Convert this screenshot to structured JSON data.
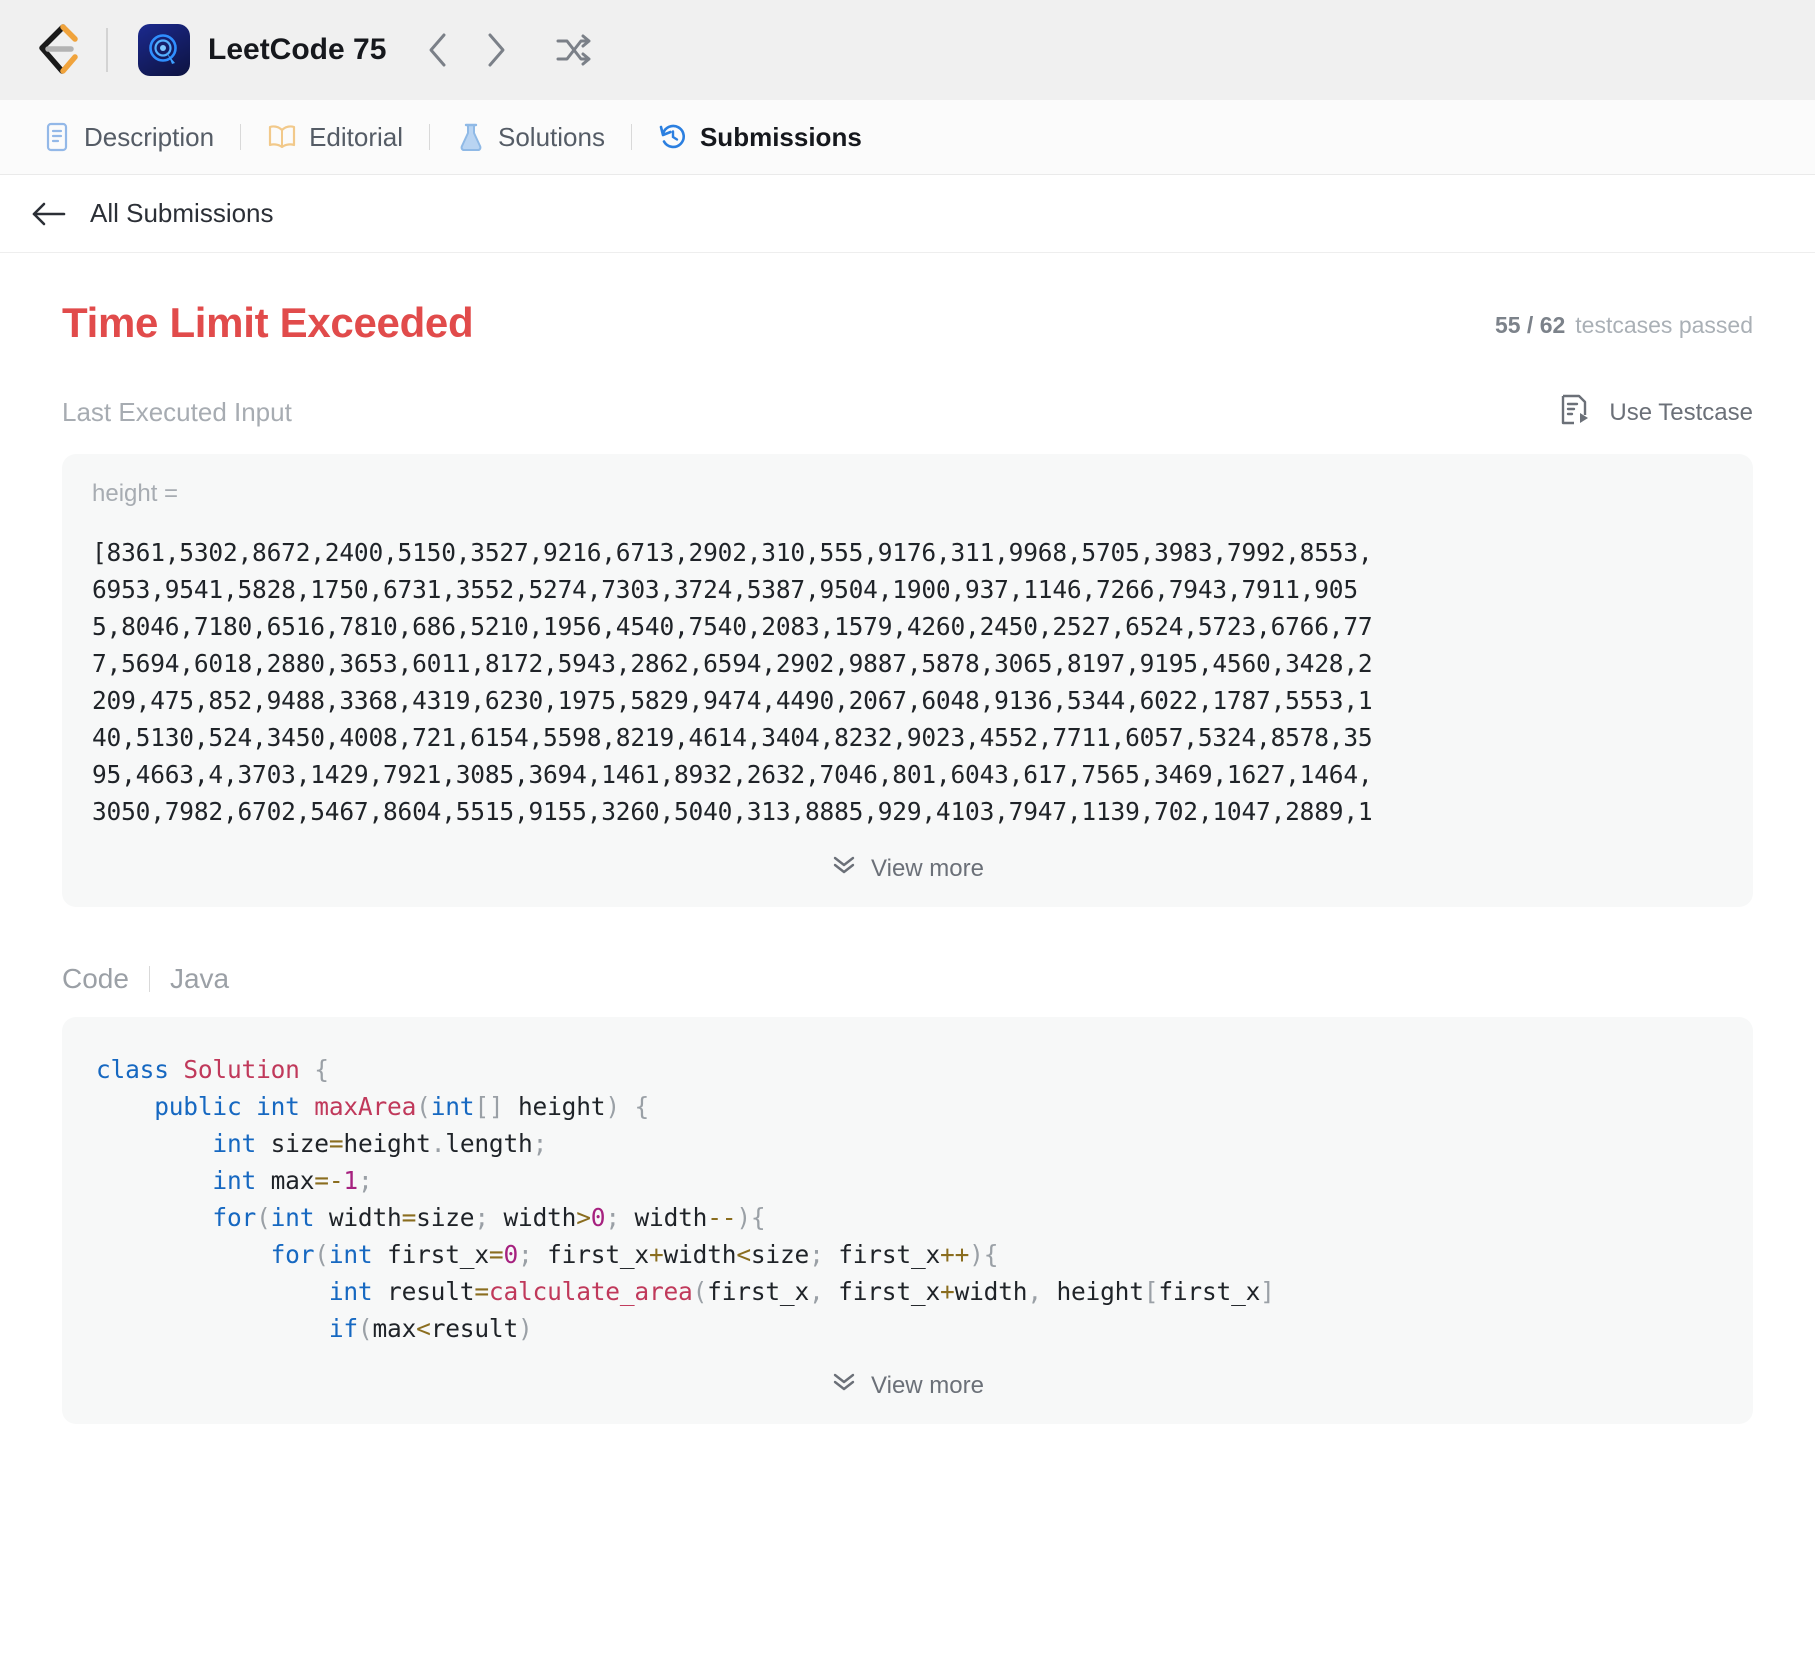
{
  "titlebar": {
    "app_name": "LeetCode 75",
    "logo_icon": "leetcode-logo-icon",
    "app_icon": "leetcode-study-plan-icon",
    "prev_icon": "chevron-left-icon",
    "next_icon": "chevron-right-icon",
    "shuffle_icon": "shuffle-icon"
  },
  "tabs": [
    {
      "label": "Description",
      "icon": "document-icon",
      "active": false
    },
    {
      "label": "Editorial",
      "icon": "book-icon",
      "active": false
    },
    {
      "label": "Solutions",
      "icon": "flask-icon",
      "active": false
    },
    {
      "label": "Submissions",
      "icon": "history-icon",
      "active": true
    }
  ],
  "submissions_bar": {
    "back_icon": "arrow-left-icon",
    "label": "All Submissions"
  },
  "result": {
    "verdict": "Time Limit Exceeded",
    "verdict_color": "#e14b4b",
    "testcases_passed": "55 / 62",
    "testcases_label": "testcases passed"
  },
  "last_executed_input": {
    "section_label": "Last Executed Input",
    "use_testcase_label": "Use Testcase",
    "use_testcase_icon": "testcase-run-icon",
    "variable_label": "height =",
    "value_lines": [
      "[8361,5302,8672,2400,5150,3527,9216,6713,2902,310,555,9176,311,9968,5705,3983,7992,8553,",
      "6953,9541,5828,1750,6731,3552,5274,7303,3724,5387,9504,1900,937,1146,7266,7943,7911,905",
      "5,8046,7180,6516,7810,686,5210,1956,4540,7540,2083,1579,4260,2450,2527,6524,5723,6766,77",
      "7,5694,6018,2880,3653,6011,8172,5943,2862,6594,2902,9887,5878,3065,8197,9195,4560,3428,2",
      "209,475,852,9488,3368,4319,6230,1975,5829,9474,4490,2067,6048,9136,5344,6022,1787,5553,1",
      "40,5130,524,3450,4008,721,6154,5598,8219,4614,3404,8232,9023,4552,7711,6057,5324,8578,35",
      "95,4663,4,3703,1429,7921,3085,3694,1461,8932,2632,7046,801,6043,617,7565,3469,1627,1464,",
      "3050,7982,6702,5467,8604,5515,9155,3260,5040,313,8885,929,4103,7947,1139,702,1047,2889,1"
    ],
    "view_more_label": "View more",
    "view_more_icon": "chevron-double-down-icon"
  },
  "code_section": {
    "code_label": "Code",
    "language_label": "Java",
    "view_more_label": "View more",
    "view_more_icon": "chevron-double-down-icon",
    "source_lines": [
      [
        {
          "t": "class ",
          "c": "kw"
        },
        {
          "t": "Solution",
          "c": "typ"
        },
        {
          "t": " ",
          "c": "id"
        },
        {
          "t": "{",
          "c": "pun"
        }
      ],
      [
        {
          "t": "    ",
          "c": "id"
        },
        {
          "t": "public ",
          "c": "kw"
        },
        {
          "t": "int ",
          "c": "kw"
        },
        {
          "t": "maxArea",
          "c": "typ"
        },
        {
          "t": "(",
          "c": "pun"
        },
        {
          "t": "int",
          "c": "kw"
        },
        {
          "t": "[]",
          "c": "pun"
        },
        {
          "t": " height",
          "c": "id"
        },
        {
          "t": ")",
          "c": "pun"
        },
        {
          "t": " ",
          "c": "id"
        },
        {
          "t": "{",
          "c": "pun"
        }
      ],
      [
        {
          "t": "        ",
          "c": "id"
        },
        {
          "t": "int",
          "c": "kw"
        },
        {
          "t": " size",
          "c": "id"
        },
        {
          "t": "=",
          "c": "op"
        },
        {
          "t": "height",
          "c": "id"
        },
        {
          "t": ".",
          "c": "pun"
        },
        {
          "t": "length",
          "c": "id"
        },
        {
          "t": ";",
          "c": "pun"
        }
      ],
      [
        {
          "t": "        ",
          "c": "id"
        },
        {
          "t": "int",
          "c": "kw"
        },
        {
          "t": " max",
          "c": "id"
        },
        {
          "t": "=-",
          "c": "op"
        },
        {
          "t": "1",
          "c": "num"
        },
        {
          "t": ";",
          "c": "pun"
        }
      ],
      [
        {
          "t": "        ",
          "c": "id"
        },
        {
          "t": "for",
          "c": "kw"
        },
        {
          "t": "(",
          "c": "pun"
        },
        {
          "t": "int",
          "c": "kw"
        },
        {
          "t": " width",
          "c": "id"
        },
        {
          "t": "=",
          "c": "op"
        },
        {
          "t": "size",
          "c": "id"
        },
        {
          "t": ";",
          "c": "pun"
        },
        {
          "t": " width",
          "c": "id"
        },
        {
          "t": ">",
          "c": "op"
        },
        {
          "t": "0",
          "c": "num"
        },
        {
          "t": ";",
          "c": "pun"
        },
        {
          "t": " width",
          "c": "id"
        },
        {
          "t": "--",
          "c": "op"
        },
        {
          "t": ")",
          "c": "pun"
        },
        {
          "t": "{",
          "c": "pun"
        }
      ],
      [
        {
          "t": "            ",
          "c": "id"
        },
        {
          "t": "for",
          "c": "kw"
        },
        {
          "t": "(",
          "c": "pun"
        },
        {
          "t": "int",
          "c": "kw"
        },
        {
          "t": " first_x",
          "c": "id"
        },
        {
          "t": "=",
          "c": "op"
        },
        {
          "t": "0",
          "c": "num"
        },
        {
          "t": ";",
          "c": "pun"
        },
        {
          "t": " first_x",
          "c": "id"
        },
        {
          "t": "+",
          "c": "op"
        },
        {
          "t": "width",
          "c": "id"
        },
        {
          "t": "<",
          "c": "op"
        },
        {
          "t": "size",
          "c": "id"
        },
        {
          "t": ";",
          "c": "pun"
        },
        {
          "t": " first_x",
          "c": "id"
        },
        {
          "t": "++",
          "c": "op"
        },
        {
          "t": ")",
          "c": "pun"
        },
        {
          "t": "{",
          "c": "pun"
        }
      ],
      [
        {
          "t": "                ",
          "c": "id"
        },
        {
          "t": "int",
          "c": "kw"
        },
        {
          "t": " result",
          "c": "id"
        },
        {
          "t": "=",
          "c": "op"
        },
        {
          "t": "calculate_area",
          "c": "typ"
        },
        {
          "t": "(",
          "c": "pun"
        },
        {
          "t": "first_x",
          "c": "id"
        },
        {
          "t": ",",
          "c": "pun"
        },
        {
          "t": " first_x",
          "c": "id"
        },
        {
          "t": "+",
          "c": "op"
        },
        {
          "t": "width",
          "c": "id"
        },
        {
          "t": ",",
          "c": "pun"
        },
        {
          "t": " height",
          "c": "id"
        },
        {
          "t": "[",
          "c": "pun"
        },
        {
          "t": "first_x",
          "c": "id"
        },
        {
          "t": "]",
          "c": "pun"
        }
      ],
      [
        {
          "t": "                ",
          "c": "id"
        },
        {
          "t": "if",
          "c": "kw"
        },
        {
          "t": "(",
          "c": "pun"
        },
        {
          "t": "max",
          "c": "id"
        },
        {
          "t": "<",
          "c": "op"
        },
        {
          "t": "result",
          "c": "id"
        },
        {
          "t": ")",
          "c": "pun"
        }
      ]
    ]
  }
}
